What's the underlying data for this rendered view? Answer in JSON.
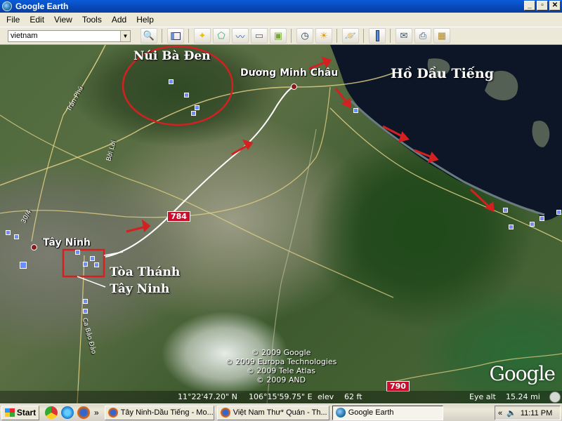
{
  "window": {
    "title": "Google Earth",
    "controls": {
      "minimize": "_",
      "restore": "▫",
      "close": "✕"
    }
  },
  "menu": [
    "File",
    "Edit",
    "View",
    "Tools",
    "Add",
    "Help"
  ],
  "toolbar": {
    "search_value": "vietnam",
    "buttons": [
      "search-icon",
      "sidebar-icon",
      "placemark-icon",
      "polygon-icon",
      "path-icon",
      "image-overlay-icon",
      "record-tour-icon",
      "historical-imagery-icon",
      "sunlight-icon",
      "planet-icon",
      "ruler-icon",
      "email-icon",
      "print-icon",
      "view-in-maps-icon"
    ]
  },
  "map": {
    "labels": {
      "nui_ba_den": "Núi Bà Đen",
      "duong_minh_chau": "Dương Minh Châu",
      "ho_dau_tieng": "Hồ Dầu Tiếng",
      "tay_ninh": "Tây Ninh",
      "toa_thanh_1": "Tòa Thánh",
      "toa_thanh_2": "Tây Ninh",
      "tran_phu": "Trần Phú",
      "boi_loi": "Bời Lời",
      "road_30_4": "30/4",
      "ca_bao_dao": "Ca Bảo Đảo"
    },
    "routes": {
      "r784": "784",
      "r790": "790"
    },
    "copyrights": [
      "© 2009 Google",
      "© 2009 Europa Technologies",
      "© 2009 Tele Atlas",
      "© 2009 AND"
    ],
    "logo": "Google",
    "status": {
      "lat": "11°22'47.20\" N",
      "lon": "106°15'59.75\" E",
      "elev_label": "elev",
      "elev": "62 ft",
      "eye_alt_label": "Eye alt",
      "eye_alt": "15.24 mi"
    }
  },
  "taskbar": {
    "start": "Start",
    "more": "»",
    "tasks": [
      "Tây Ninh-Dầu Tiếng - Mo...",
      "Việt Nam Thư* Quán - Th...",
      "Google Earth"
    ],
    "tray_more": "«",
    "clock": "11:11 PM"
  },
  "colors": {
    "titlebar": "#0a5cd8",
    "route_badge": "#c8102e",
    "annotation_red": "#d42020",
    "lake": "#0c1626"
  }
}
